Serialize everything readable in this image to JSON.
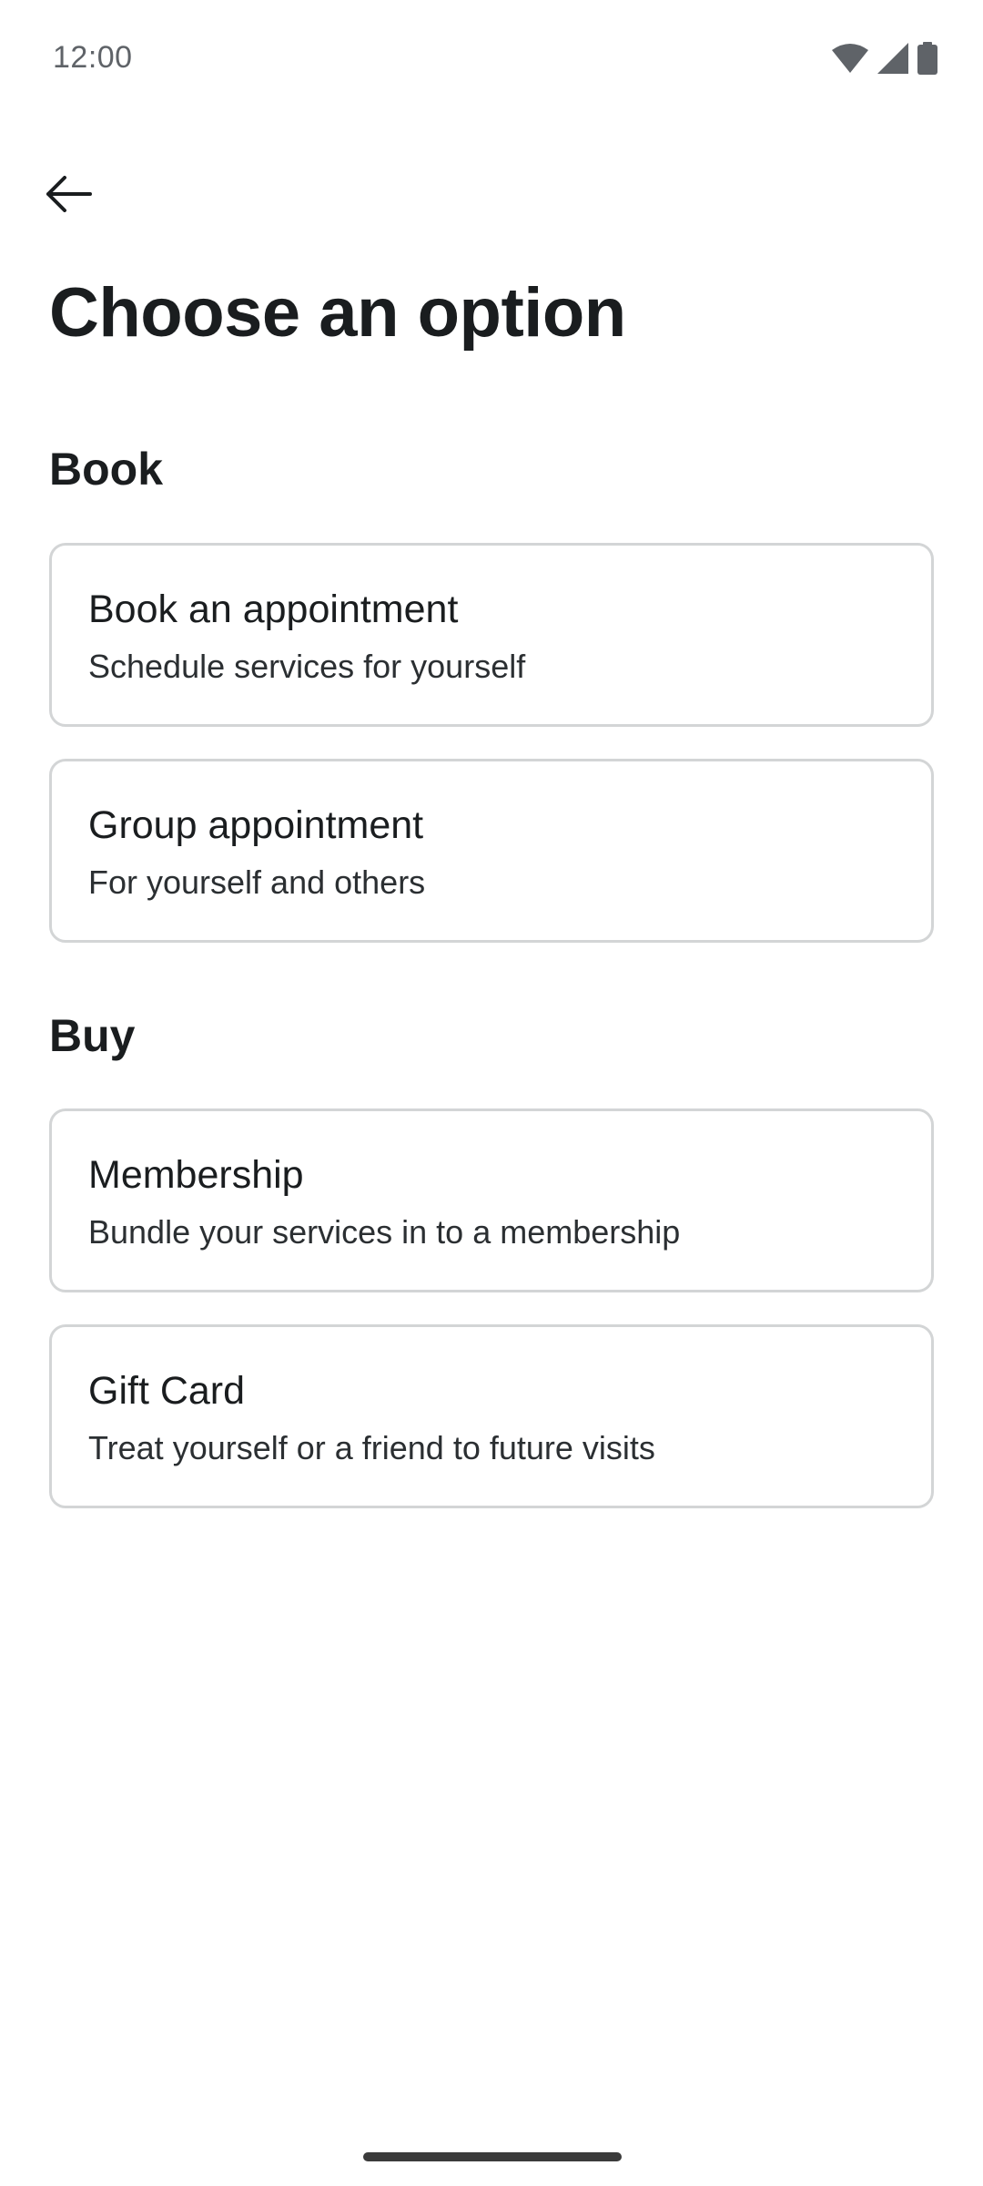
{
  "status_bar": {
    "time": "12:00",
    "icons": [
      "wifi-icon",
      "cellular-signal-icon",
      "battery-icon"
    ]
  },
  "header": {
    "back_icon": "arrow-left-icon",
    "title": "Choose an option"
  },
  "sections": [
    {
      "heading": "Book",
      "options": [
        {
          "title": "Book an appointment",
          "subtitle": "Schedule services for yourself"
        },
        {
          "title": "Group appointment",
          "subtitle": "For yourself and others"
        }
      ]
    },
    {
      "heading": "Buy",
      "options": [
        {
          "title": "Membership",
          "subtitle": "Bundle your services in to a membership"
        },
        {
          "title": "Gift Card",
          "subtitle": "Treat yourself or a friend to future visits"
        }
      ]
    }
  ],
  "colors": {
    "text": "#1a1d1f",
    "card_border": "#d3d5d6",
    "status_text": "#5f6368"
  }
}
